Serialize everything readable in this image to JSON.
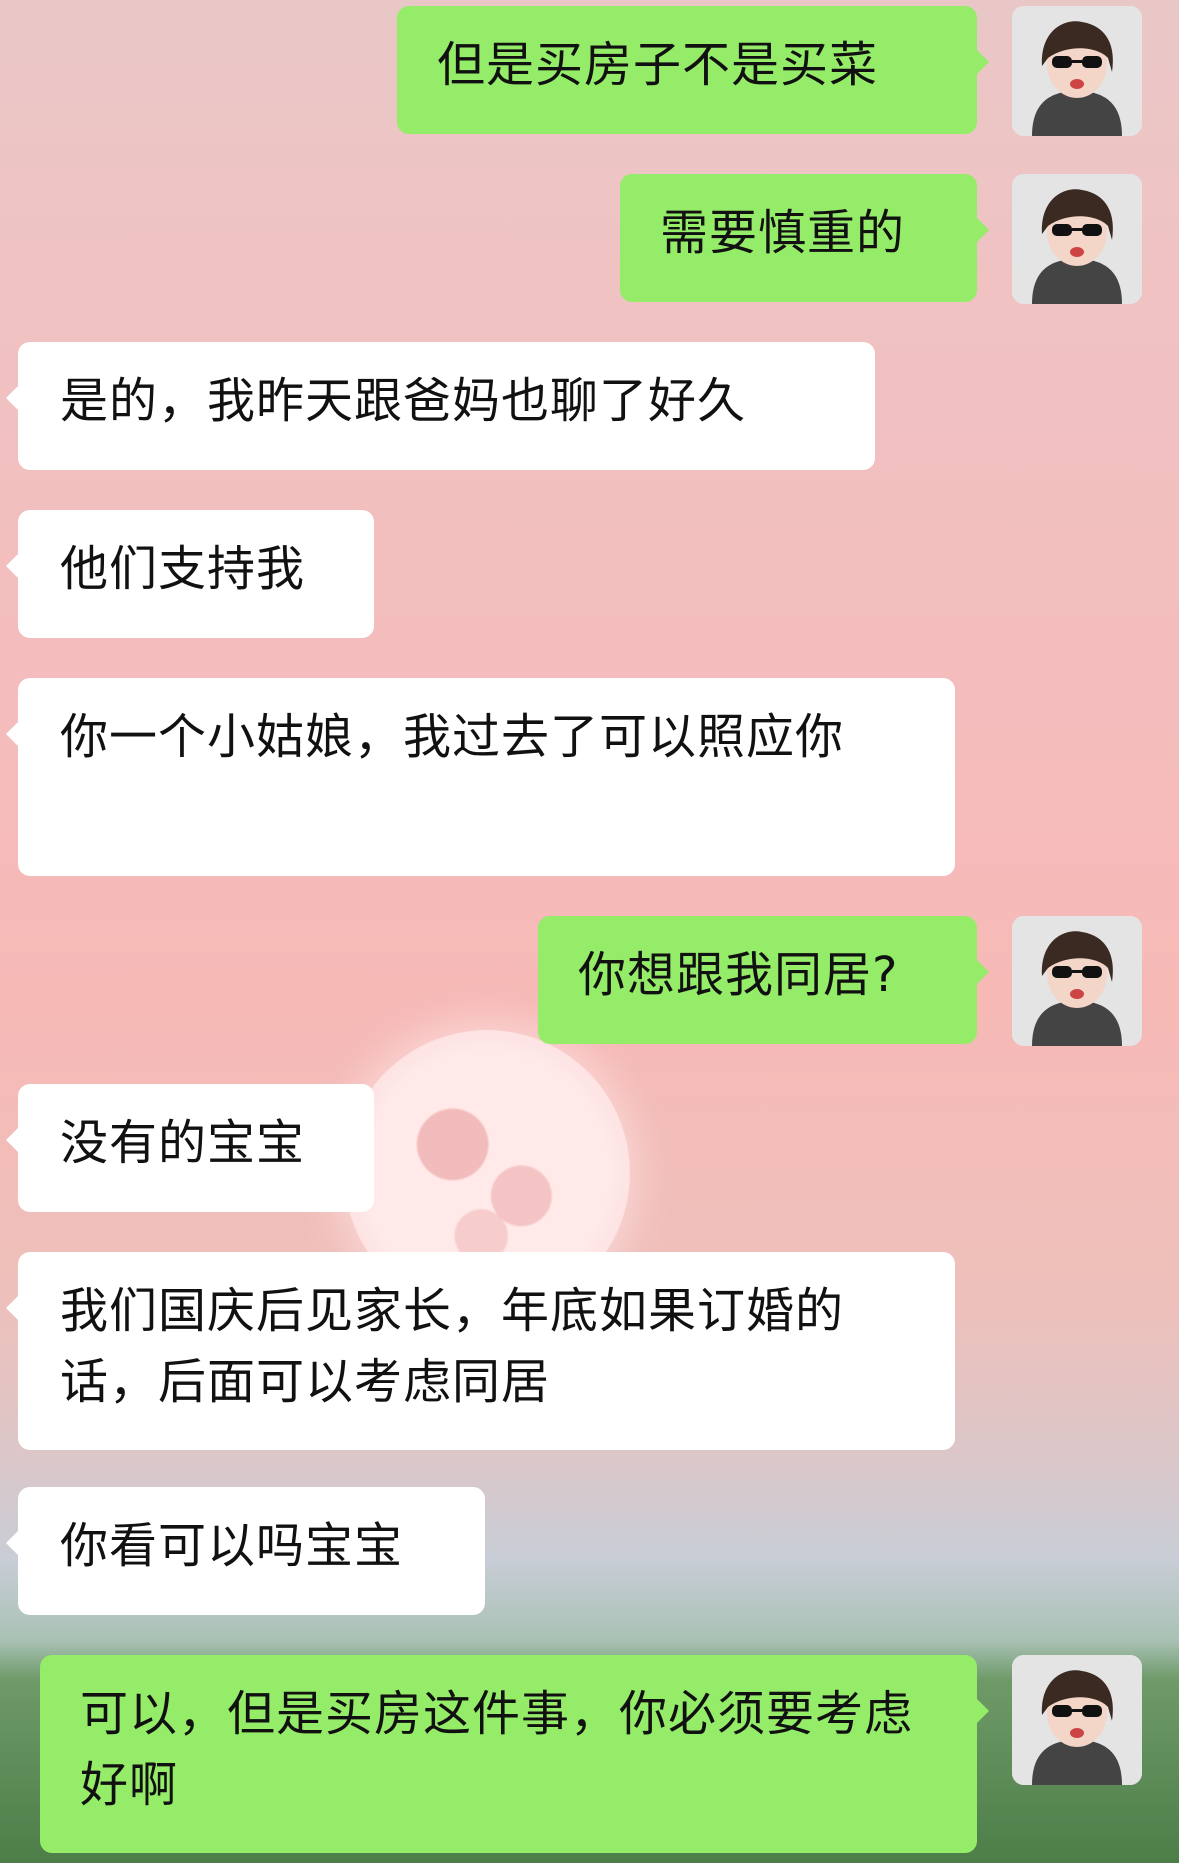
{
  "messages": [
    {
      "side": "right",
      "text": "但是买房子不是买菜"
    },
    {
      "side": "right",
      "text": "需要慎重的"
    },
    {
      "side": "left",
      "text": "是的，我昨天跟爸妈也聊了好久"
    },
    {
      "side": "left",
      "text": "他们支持我"
    },
    {
      "side": "left",
      "text": "你一个小姑娘，我过去了可以照应你"
    },
    {
      "side": "right",
      "text": "你想跟我同居?"
    },
    {
      "side": "left",
      "text": "没有的宝宝"
    },
    {
      "side": "left",
      "text": "我们国庆后见家长，年底如果订婚的话，后面可以考虑同居"
    },
    {
      "side": "left",
      "text": "你看可以吗宝宝"
    },
    {
      "side": "right",
      "text": "可以，但是买房这件事，你必须要考虑好啊"
    }
  ],
  "avatar_icon": "user-avatar-icon",
  "colors": {
    "sent_bubble": "#95ec69",
    "received_bubble": "#ffffff",
    "text": "#111111"
  }
}
